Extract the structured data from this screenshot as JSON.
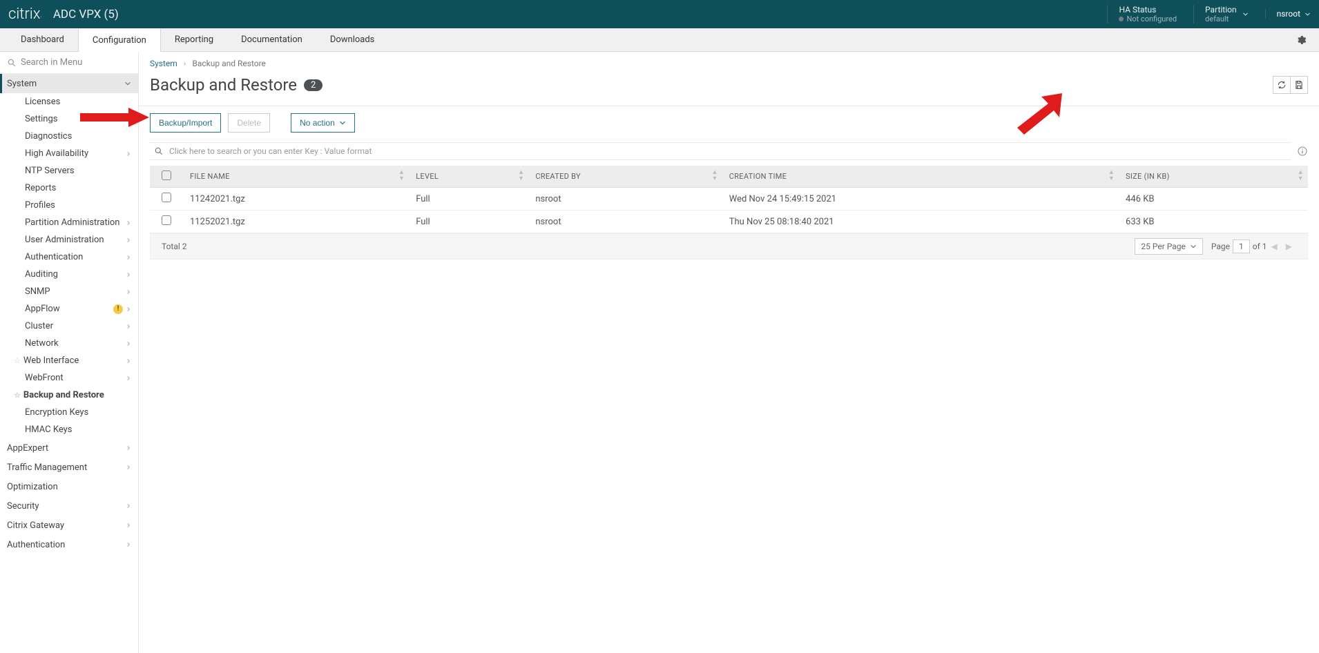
{
  "topbar": {
    "logo": "citrix",
    "product": "ADC VPX (5)",
    "ha_status_label": "HA Status",
    "ha_status_value": "Not configured",
    "partition_label": "Partition",
    "partition_value": "default",
    "user": "nsroot"
  },
  "navtabs": [
    "Dashboard",
    "Configuration",
    "Reporting",
    "Documentation",
    "Downloads"
  ],
  "sidebar": {
    "search_placeholder": "Search in Menu",
    "system_label": "System",
    "system_items": [
      {
        "label": "Licenses"
      },
      {
        "label": "Settings"
      },
      {
        "label": "Diagnostics"
      },
      {
        "label": "High Availability",
        "chev": true
      },
      {
        "label": "NTP Servers"
      },
      {
        "label": "Reports"
      },
      {
        "label": "Profiles"
      },
      {
        "label": "Partition Administration",
        "chev": true
      },
      {
        "label": "User Administration",
        "chev": true
      },
      {
        "label": "Authentication",
        "chev": true
      },
      {
        "label": "Auditing",
        "chev": true
      },
      {
        "label": "SNMP",
        "chev": true
      },
      {
        "label": "AppFlow",
        "chev": true,
        "warn": true
      },
      {
        "label": "Cluster",
        "chev": true
      },
      {
        "label": "Network",
        "chev": true
      },
      {
        "label": "Web Interface",
        "chev": true,
        "star": true
      },
      {
        "label": "WebFront",
        "chev": true
      },
      {
        "label": "Backup and Restore",
        "star": true,
        "bold": true
      },
      {
        "label": "Encryption Keys"
      },
      {
        "label": "HMAC Keys"
      }
    ],
    "root_items": [
      {
        "label": "AppExpert",
        "chev": true
      },
      {
        "label": "Traffic Management",
        "chev": true
      },
      {
        "label": "Optimization"
      },
      {
        "label": "Security",
        "chev": true
      },
      {
        "label": "Citrix Gateway",
        "chev": true
      },
      {
        "label": "Authentication",
        "chev": true
      }
    ]
  },
  "breadcrumbs": {
    "root": "System",
    "current": "Backup and Restore"
  },
  "page": {
    "title": "Backup and Restore",
    "count": "2"
  },
  "toolbar": {
    "backup": "Backup/Import",
    "delete": "Delete",
    "noaction": "No action"
  },
  "search_placeholder": "Click here to search or you can enter Key : Value format",
  "table": {
    "columns": [
      "FILE NAME",
      "LEVEL",
      "CREATED BY",
      "CREATION TIME",
      "SIZE (IN KB)"
    ],
    "rows": [
      {
        "file": "11242021.tgz",
        "level": "Full",
        "by": "nsroot",
        "time": "Wed Nov 24 15:49:15 2021",
        "size": "446 KB"
      },
      {
        "file": "11252021.tgz",
        "level": "Full",
        "by": "nsroot",
        "time": "Thu Nov 25 08:18:40 2021",
        "size": "633 KB"
      }
    ]
  },
  "footer": {
    "total_label": "Total",
    "total_value": "2",
    "per_page": "25 Per Page",
    "page_label": "Page",
    "page_current": "1",
    "page_of": "of 1"
  }
}
